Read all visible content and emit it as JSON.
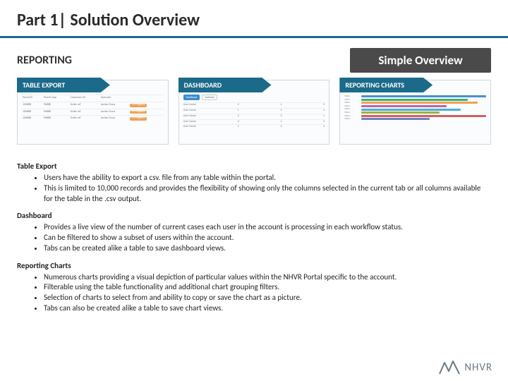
{
  "title": "Part 1| Solution Overview",
  "section_label": "REPORTING",
  "overview_label": "Simple Overview",
  "panels": {
    "table_export": {
      "label": "TABLE EXPORT"
    },
    "dashboard": {
      "label": "DASHBOARD"
    },
    "charts": {
      "label": "REPORTING CHARTS"
    }
  },
  "sections": {
    "table_export": {
      "heading": "Table Export",
      "bullets": [
        "Users have the ability to export a csv. file from any table within the portal.",
        "This is limited to 10,000 records and provides the flexibility of showing only the columns selected in the current tab or all columns available for the table in the .csv output."
      ]
    },
    "dashboard": {
      "heading": "Dashboard",
      "bullets": [
        "Provides a live view of the number of current cases each user in the account is processing in each workflow status.",
        "Can be filtered to show a subset of users within the account.",
        "Tabs can be created alike a table to save dashboard views."
      ]
    },
    "charts": {
      "heading": "Reporting Charts",
      "bullets": [
        "Numerous charts providing a visual depiction of particular values within the NHVR Portal specific to the account.",
        "Filterable using the table functionality and additional chart grouping filters.",
        "Selection of charts to select from and ability to copy or save the chart as a picture.",
        "Tabs can also be created alike a table to save chart views."
      ]
    }
  },
  "logo_text": "NHVR",
  "thumbnails": {
    "table": {
      "headers": [
        "Portal ID",
        "Permit App",
        "Customer ref",
        "Operator"
      ],
      "rows": [
        [
          "100###",
          "PA###",
          "Order ref",
          "Jordan Trans"
        ],
        [
          "100###",
          "PA###",
          "Order ref",
          "Jordan Trans"
        ],
        [
          "100###",
          "PA###",
          "Order ref",
          "Jordan Trans"
        ]
      ],
      "chips": [
        "In Progress",
        "In Progress",
        "In Progress"
      ]
    },
    "dashboard": {
      "buttons": [
        "Dashboard",
        "Customer"
      ],
      "rows": [
        [
          "User Name",
          "2",
          "1",
          "3"
        ],
        [
          "User Name",
          "1",
          "4",
          "2"
        ],
        [
          "User Name",
          "3",
          "2",
          "1"
        ],
        [
          "User Name",
          "2",
          "1",
          "5"
        ],
        [
          "User Name",
          "1",
          "3",
          "2"
        ]
      ]
    },
    "charts": {
      "bars": [
        {
          "label": "Metric",
          "width": 88,
          "color": "#4a90d0"
        },
        {
          "label": "Metric",
          "width": 75,
          "color": "#40b070"
        },
        {
          "label": "Metric",
          "width": 82,
          "color": "#f0a050"
        },
        {
          "label": "Metric",
          "width": 60,
          "color": "#c060b0"
        },
        {
          "label": "Metric",
          "width": 70,
          "color": "#4ab0d0"
        },
        {
          "label": "Metric",
          "width": 55,
          "color": "#a0b040"
        },
        {
          "label": "Metric",
          "width": 90,
          "color": "#d06060"
        },
        {
          "label": "Metric",
          "width": 48,
          "color": "#7080c0"
        }
      ]
    }
  }
}
